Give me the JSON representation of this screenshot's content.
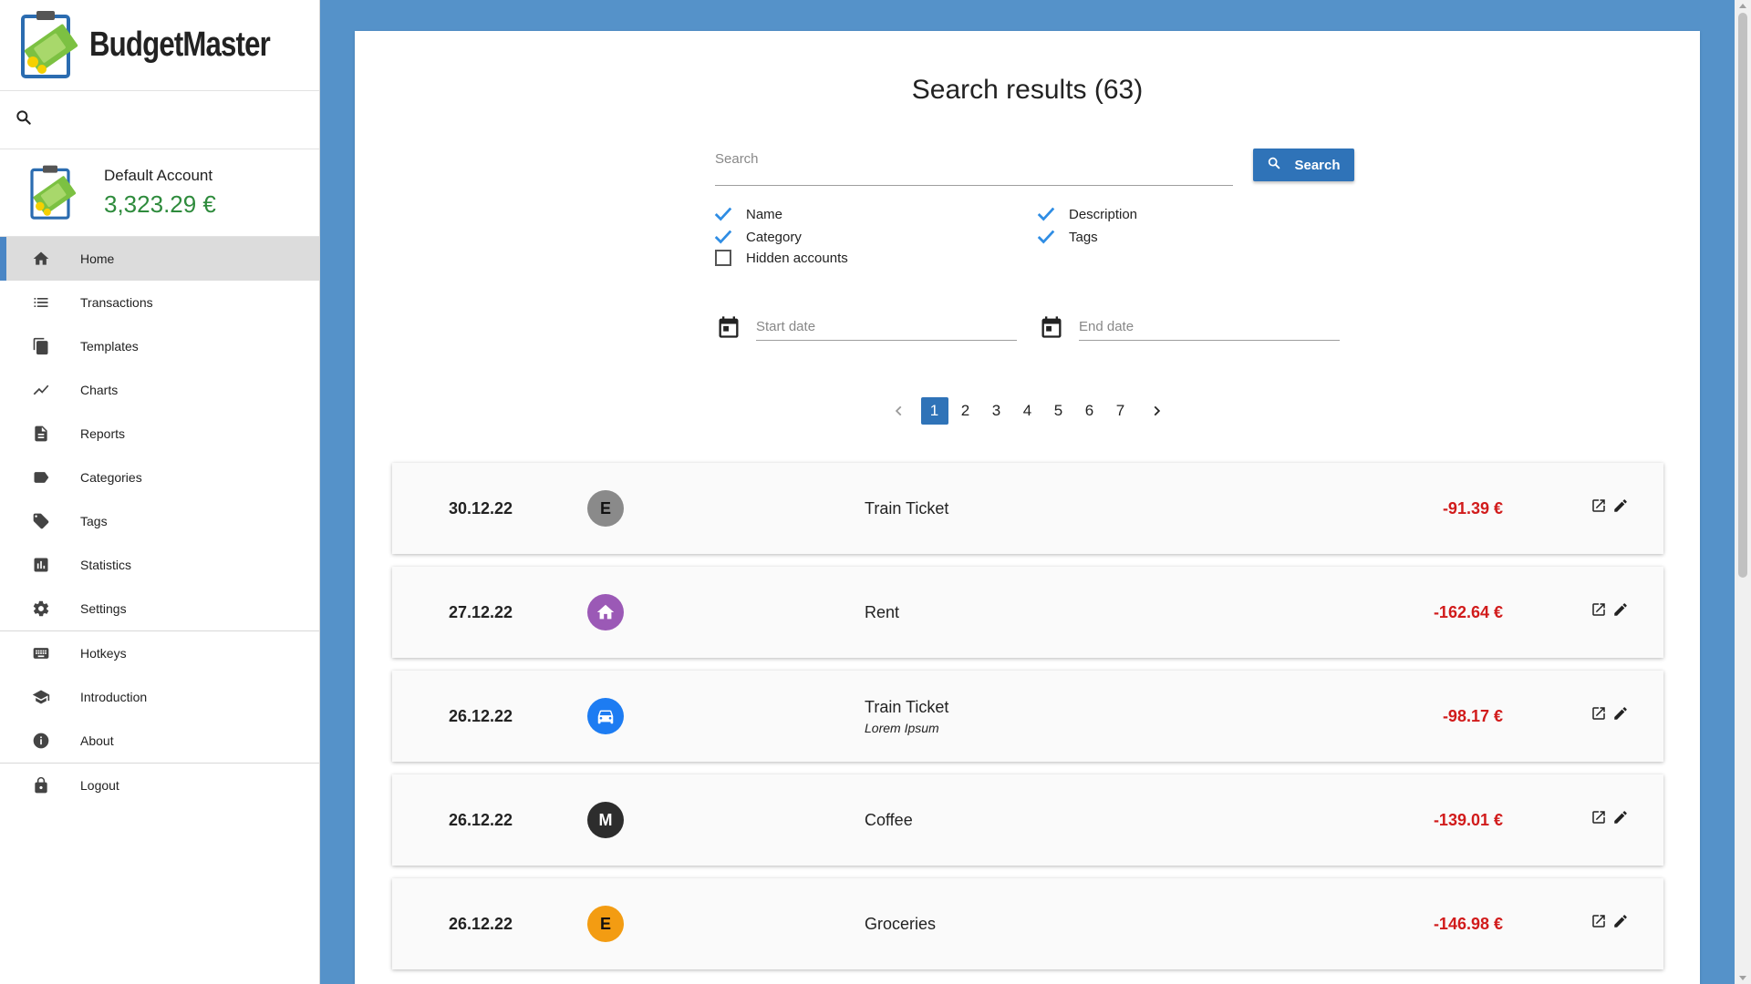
{
  "app": {
    "name": "BudgetMaster"
  },
  "account": {
    "name": "Default Account",
    "balance": "3,323.29 €"
  },
  "nav": {
    "items": [
      {
        "label": "Home",
        "icon": "home-icon",
        "active": true
      },
      {
        "label": "Transactions",
        "icon": "list-icon"
      },
      {
        "label": "Templates",
        "icon": "copy-icon"
      },
      {
        "label": "Charts",
        "icon": "line-chart-icon"
      },
      {
        "label": "Reports",
        "icon": "document-icon"
      },
      {
        "label": "Categories",
        "icon": "label-icon"
      },
      {
        "label": "Tags",
        "icon": "tag-icon"
      },
      {
        "label": "Statistics",
        "icon": "bar-chart-icon"
      },
      {
        "label": "Settings",
        "icon": "gear-icon"
      },
      {
        "label": "Hotkeys",
        "icon": "keyboard-icon"
      },
      {
        "label": "Introduction",
        "icon": "school-icon"
      },
      {
        "label": "About",
        "icon": "info-icon"
      },
      {
        "label": "Logout",
        "icon": "lock-icon"
      }
    ]
  },
  "search": {
    "title": "Search results (63)",
    "placeholder": "Search",
    "button_label": "Search",
    "filters": {
      "name": {
        "label": "Name",
        "checked": true
      },
      "description": {
        "label": "Description",
        "checked": true
      },
      "category": {
        "label": "Category",
        "checked": true
      },
      "tags": {
        "label": "Tags",
        "checked": true
      },
      "hidden_accounts": {
        "label": "Hidden accounts",
        "checked": false
      }
    },
    "start_date_placeholder": "Start date",
    "end_date_placeholder": "End date"
  },
  "pagination": {
    "pages": [
      "1",
      "2",
      "3",
      "4",
      "5",
      "6",
      "7"
    ],
    "current": "1"
  },
  "transactions": [
    {
      "date": "30.12.22",
      "avatar": "E",
      "avatar_color": "#8a8a8a",
      "name": "Train Ticket",
      "description": "",
      "amount": "-91.39 €"
    },
    {
      "date": "27.12.22",
      "avatar": "home-icon",
      "avatar_color": "#9b59b6",
      "name": "Rent",
      "description": "",
      "amount": "-162.64 €"
    },
    {
      "date": "26.12.22",
      "avatar": "car-icon",
      "avatar_color": "#1d7cf2",
      "name": "Train Ticket",
      "description": "Lorem Ipsum",
      "amount": "-98.17 €"
    },
    {
      "date": "26.12.22",
      "avatar": "M",
      "avatar_color": "#2d2d2d",
      "name": "Coffee",
      "description": "",
      "amount": "-139.01 €"
    },
    {
      "date": "26.12.22",
      "avatar": "E",
      "avatar_color": "#f39c12",
      "name": "Groceries",
      "description": "",
      "amount": "-146.98 €"
    }
  ],
  "colors": {
    "accent": "#2f73b8",
    "background": "#5592c9",
    "negative": "#d11b1b",
    "balance": "#2e8b3c"
  }
}
